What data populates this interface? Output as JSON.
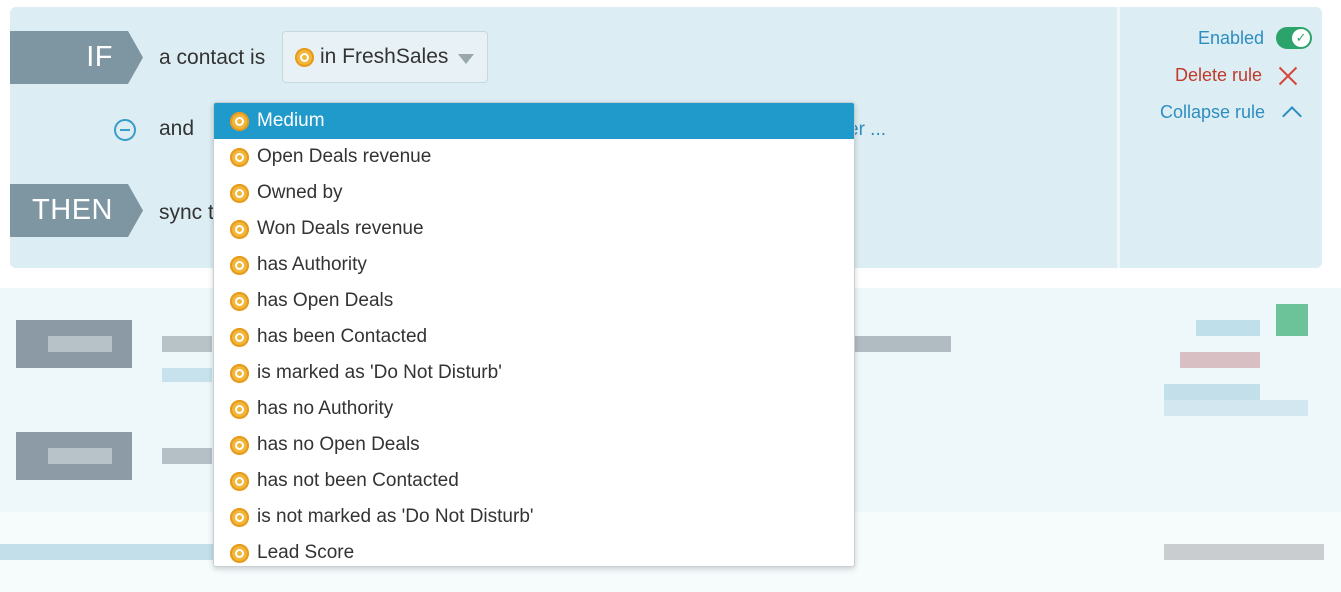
{
  "rule": {
    "if_label": "IF",
    "then_label": "THEN",
    "contact_text": "a contact is",
    "and_text": "and",
    "sync_text": "sync t",
    "source_select_value": "in FreshSales",
    "partial_link_text": "er ..."
  },
  "controls": {
    "enabled_label": "Enabled",
    "enabled_state": true,
    "delete_label": "Delete rule",
    "collapse_label": "Collapse rule"
  },
  "dropdown": {
    "items": [
      {
        "label": "Medium",
        "active": true
      },
      {
        "label": "Open Deals revenue"
      },
      {
        "label": "Owned by"
      },
      {
        "label": "Won Deals revenue"
      },
      {
        "label": "has Authority"
      },
      {
        "label": "has Open Deals"
      },
      {
        "label": "has been Contacted"
      },
      {
        "label": "is marked as 'Do Not Disturb'"
      },
      {
        "label": "has no Authority"
      },
      {
        "label": "has no Open Deals"
      },
      {
        "label": "has not been Contacted"
      },
      {
        "label": "is not marked as 'Do Not Disturb'"
      },
      {
        "label": "Lead Score"
      }
    ]
  },
  "icons": {
    "freshsales": "freshsales-icon",
    "remove": "minus-circle-icon",
    "delete": "close-icon",
    "collapse": "chevron-up-icon",
    "toggle_check": "check-icon"
  },
  "colors": {
    "panel_bg": "#dceef4",
    "chevron": "#7e95a2",
    "accent": "#1f9acb",
    "toggle_on": "#2ba36b",
    "danger": "#c0392b"
  }
}
